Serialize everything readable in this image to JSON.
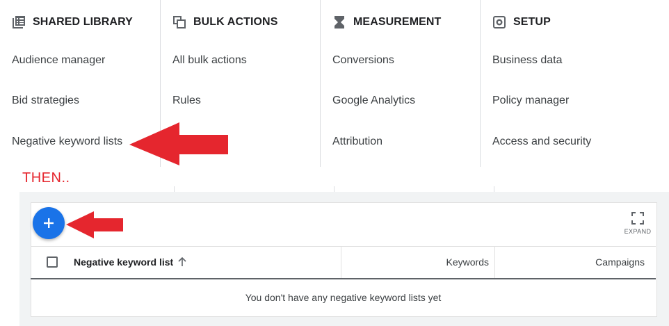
{
  "menu": {
    "columns": [
      {
        "title": "SHARED LIBRARY",
        "icon": "library-icon",
        "items": [
          "Audience manager",
          "Bid strategies",
          "Negative keyword lists"
        ]
      },
      {
        "title": "BULK ACTIONS",
        "icon": "bulk-copy-icon",
        "items": [
          "All bulk actions",
          "Rules"
        ]
      },
      {
        "title": "MEASUREMENT",
        "icon": "hourglass-icon",
        "items": [
          "Conversions",
          "Google Analytics",
          "Attribution"
        ]
      },
      {
        "title": "SETUP",
        "icon": "settings-icon",
        "items": [
          "Business data",
          "Policy manager",
          "Access and security"
        ]
      }
    ]
  },
  "annotation": {
    "then_label": "THEN..",
    "arrow_color": "#e5262e"
  },
  "toolbar": {
    "add_icon": "plus-icon",
    "expand_label": "EXPAND",
    "expand_icon": "fullscreen-icon"
  },
  "table": {
    "headers": {
      "name": "Negative keyword list",
      "keywords": "Keywords",
      "campaigns": "Campaigns"
    },
    "sort_icon": "arrow-up-icon",
    "empty_message": "You don't have any negative keyword lists yet"
  },
  "colors": {
    "accent": "#1a73e8",
    "text": "#202124",
    "divider": "#dadce0"
  }
}
